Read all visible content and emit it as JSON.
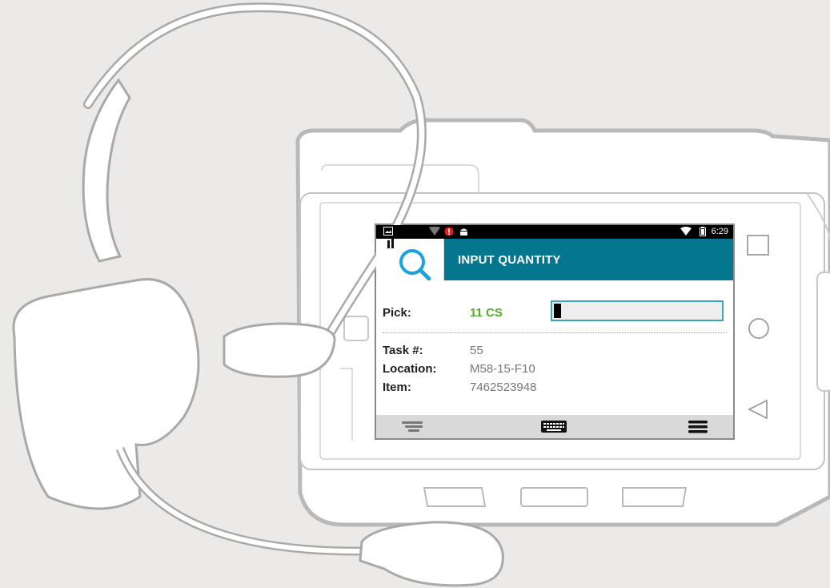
{
  "status_bar": {
    "time": "6:29",
    "left_icons": [
      "image-icon",
      "signal-icon",
      "alert-icon",
      "android-icon"
    ],
    "right_icons": [
      "wifi-icon",
      "battery-icon"
    ]
  },
  "app_bar": {
    "title": "INPUT QUANTITY",
    "logo_icon": "search-icon",
    "background": "#04778f"
  },
  "pick": {
    "label": "Pick:",
    "value": "11 CS",
    "value_color": "#4caf28",
    "input_value": ""
  },
  "details": [
    {
      "label": "Task #:",
      "value": "55"
    },
    {
      "label": "Location:",
      "value": "M58-15-F10"
    },
    {
      "label": "Item:",
      "value": "7462523948"
    }
  ],
  "bottom_bar": {
    "buttons": [
      "list-icon",
      "keyboard-icon",
      "menu-icon"
    ]
  },
  "device_nav": [
    "recent-apps-icon",
    "home-icon",
    "back-icon"
  ]
}
